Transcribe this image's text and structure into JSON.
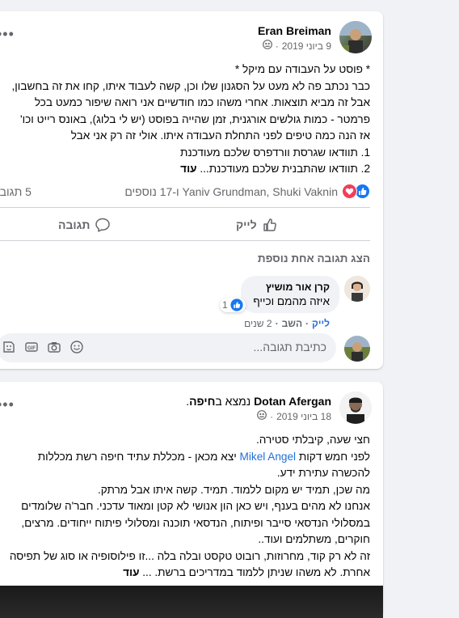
{
  "post1": {
    "author": "Eran Breiman",
    "date": "9 ביוני 2019",
    "separator": "·",
    "lines": [
      "* פוסט על העבודה עם מיקל *",
      "כבר נכתב פה לא מעט על הסגנון שלו וכן, קשה לעבוד איתו, קחו את זה בחשבון,",
      "אבל זה מביא תוצאות. אחרי משהו כמו חודשיים אני רואה שיפור כמעט בכל",
      "פרמטר - כמות גולשים אורגנית, זמן שהייה בפוסט (יש לי בלוג), באונס רייט וכו'",
      "אז הנה כמה טיפים לפני התחלת העבודה איתו. אולי זה רק אני אבל",
      "1. תוודאו שגרסת וורדפרס שלכם מעודכנת",
      "2. תוודאו שהתבנית שלכם מעודכנת..."
    ],
    "see_more": "עוד",
    "reactions_text": "Yaniv Grundman, Shuki Vaknin ו‑17 נוספים",
    "comments_count": "5 תגובו",
    "like_label": "לייק",
    "comment_label": "תגובה",
    "view_more_comments": "הצג תגובה אחת נוספת",
    "comment": {
      "author": "קרן אור מושיץ",
      "text": "איזה מהמם וכייף",
      "like_count": "1",
      "like_action": "לייק",
      "reply_action": "השב",
      "time": "2 שנים"
    },
    "write_comment_placeholder": "כתיבת תגובה...",
    "comment_icons": [
      "emoji-icon",
      "camera-icon",
      "gif-icon",
      "sticker-icon"
    ]
  },
  "post2": {
    "author": "Dotan Afergan",
    "location_prefix": "נמצא ב",
    "location": "חיפה",
    "location_suffix": ".",
    "date": "18 ביוני 2019",
    "separator": "·",
    "lines": [
      "חצי שעה, קיבלתי סטירה.",
      "לפני חמש דקות",
      "להכשרה עתירת ידע.",
      "מה שכן, תמיד יש מקום ללמוד. תמיד. קשה איתו אבל מרתק.",
      "אנחנו לא מהים בענף, ויש כאן הון אנושי לא קטן ומאוד עדכני. חבר'ה שלומדים",
      "במסלולי הנדסאי סייבר ופיתוח, הנדסאי תוכנה ומסלולי פיתוח ייחודים. מרצים,",
      "חוקרים, משתלמים ועוד..",
      "זה לא רק קוד, מחרוזות, רובוט טקסט ובלה בלה ...זו פילוסופיה או סוג של תפיסה",
      "אחרת. לא משהו שניתן ללמוד במדריכים ברשת. ..."
    ],
    "mention": "Mikel Angel",
    "line2_suffix": "יצא מכאן - מכללת עתיד חיפה רשת מכללות",
    "see_more": "עוד"
  },
  "colors": {
    "page_bg": "#f0f2f5",
    "link_blue": "#216fdb",
    "like_blue": "#1877f2",
    "love_red": "#f33e58",
    "secondary_text": "#65676b"
  }
}
